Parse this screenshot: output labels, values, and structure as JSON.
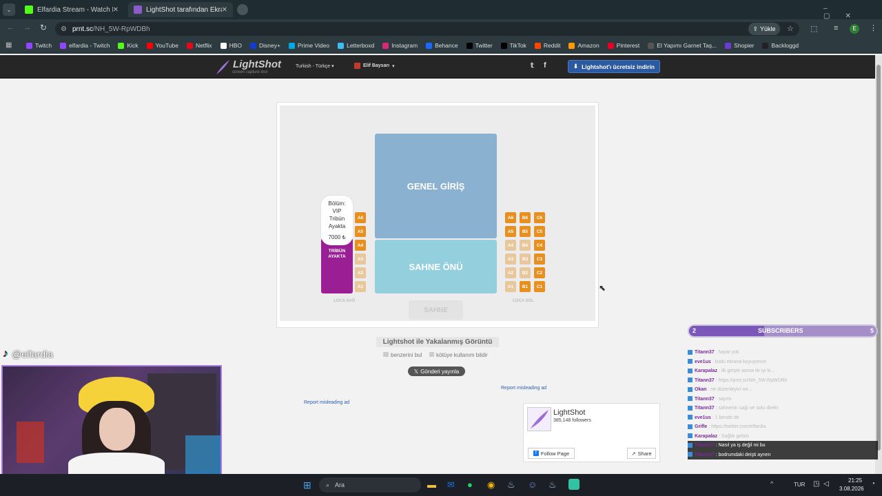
{
  "browser": {
    "tabs": [
      {
        "label": "Elfardia Stream - Watch Live or",
        "active": false
      },
      {
        "label": "LightShot tarafından Ekran Görü",
        "active": true
      }
    ],
    "url_host": "prnt.sc",
    "url_path": "/NH_5W-RpWDBh",
    "upload_label": "Yükle",
    "profile_initial": "E",
    "bookmarks": [
      {
        "label": "Twitch",
        "color": "#9146ff"
      },
      {
        "label": "elfardia - Twitch",
        "color": "#9146ff"
      },
      {
        "label": "Kick",
        "color": "#53fc18"
      },
      {
        "label": "YouTube",
        "color": "#ff0000"
      },
      {
        "label": "Netflix",
        "color": "#e50914"
      },
      {
        "label": "HBO",
        "color": "#ffffff"
      },
      {
        "label": "Disney+",
        "color": "#113ccf"
      },
      {
        "label": "Prime Video",
        "color": "#00a8e1"
      },
      {
        "label": "Letterboxd",
        "color": "#40bcf4"
      },
      {
        "label": "Instagram",
        "color": "#d62976"
      },
      {
        "label": "Behance",
        "color": "#1769ff"
      },
      {
        "label": "Twitter",
        "color": "#000000"
      },
      {
        "label": "TikTok",
        "color": "#000000"
      },
      {
        "label": "Reddit",
        "color": "#ff4500"
      },
      {
        "label": "Amazon",
        "color": "#ff9900"
      },
      {
        "label": "Pinterest",
        "color": "#e60023"
      },
      {
        "label": "El Yapımı Garnet Taş...",
        "color": "#555555"
      },
      {
        "label": "Shopier",
        "color": "#6c3bd1"
      },
      {
        "label": "Backloggd",
        "color": "#222222"
      }
    ]
  },
  "lightshot": {
    "logo": "LightShot",
    "logo_sub": "screen capture tool",
    "language": "Turkish - Türkçe",
    "user": "Elif Baysarı",
    "download_label": "Lightshot'ı ücretsiz indirin",
    "caption": "Lightshot ile Yakalanmış Görüntü",
    "find_similar": "benzerini bul",
    "report_abuse": "kötüye kullanım bildir",
    "tweet_label": "Gönderi yayınla",
    "report_ad": "Report misleading ad",
    "fb_name": "LightShot",
    "fb_followers": "385,148 followers",
    "fb_follow": "Follow Page",
    "fb_share": "Share"
  },
  "seatmap": {
    "genel": "GENEL GİRİŞ",
    "sahne_onu": "SAHNE ÖNÜ",
    "sahne": "SAHNE",
    "vip_label": "TRİBÜN AYAKTA",
    "loca_sag": "LOCA SAĞ",
    "loca_sol": "LOCA SOL",
    "tooltip": {
      "line1": "Bölüm:",
      "line2": "VIP",
      "line3": "Tribün",
      "line4": "Ayakta",
      "price": "7000 ₺"
    },
    "left_col": [
      "A6",
      "A5",
      "A4",
      "A3",
      "A2",
      "A1"
    ],
    "left_avail": [
      true,
      true,
      true,
      false,
      false,
      false
    ],
    "right_cols": [
      {
        "seats": [
          "A6",
          "A5",
          "A4",
          "A3",
          "A2",
          "A1"
        ],
        "avail": [
          true,
          true,
          false,
          false,
          false,
          false
        ]
      },
      {
        "seats": [
          "B6",
          "B5",
          "B4",
          "B3",
          "B2",
          "B1"
        ],
        "avail": [
          true,
          true,
          false,
          false,
          false,
          true
        ]
      },
      {
        "seats": [
          "C6",
          "C5",
          "C4",
          "C3",
          "C2",
          "C1"
        ],
        "avail": [
          true,
          true,
          true,
          true,
          true,
          true
        ]
      }
    ]
  },
  "stream": {
    "handle": "@elfardia",
    "subs_count": "2",
    "subs_label": "SUBSCRIBERS",
    "subs_goal": "5",
    "chat": [
      {
        "user": "Titann37",
        "msg": ": hayat yok"
      },
      {
        "user": "eve1us",
        "msg": ": kodu ekrana koyuyorum"
      },
      {
        "user": "Karapalaz",
        "msg": ": ilk girişte arena ile iyi ki..."
      },
      {
        "user": "Titann37",
        "msg": ": https://prnt.sc/NH_5W-RpWDBh"
      },
      {
        "user": "Okan",
        "msg": ": ne düzenleyici ne..."
      },
      {
        "user": "Titann37",
        "msg": ": sayım"
      },
      {
        "user": "Titann37",
        "msg": ": sahnenin sağı ve solu direkt"
      },
      {
        "user": "eve1us",
        "msg": ": 1 bende de"
      },
      {
        "user": "Grifle",
        "msg": ": https://twitter.com/elfardia"
      },
      {
        "user": "Karapalaz",
        "msg": ": Sağlık gelsin"
      },
      {
        "user": "Titann37",
        "msg": ": Nasıl ya iş değil mi bu"
      },
      {
        "user": "Titann37",
        "msg": ": bodrumdaki deişti aynen"
      }
    ]
  },
  "taskbar": {
    "search": "Ara",
    "lang": "TUR",
    "time": "21:25",
    "date": "3.08.2026"
  }
}
